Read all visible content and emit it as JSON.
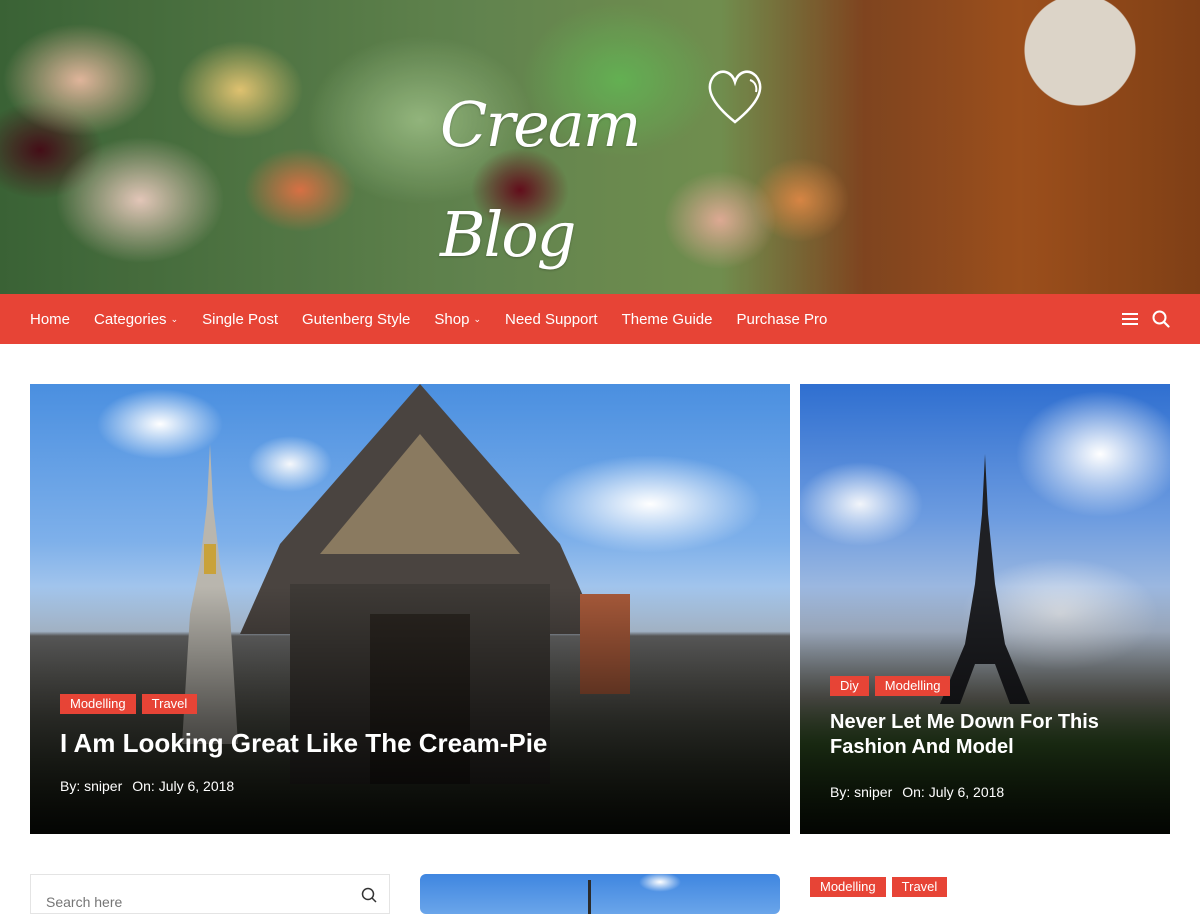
{
  "header": {
    "site_title": "Cream Blog"
  },
  "nav": {
    "items": [
      {
        "label": "Home",
        "has_dropdown": false
      },
      {
        "label": "Categories",
        "has_dropdown": true
      },
      {
        "label": "Single Post",
        "has_dropdown": false
      },
      {
        "label": "Gutenberg Style",
        "has_dropdown": false
      },
      {
        "label": "Shop",
        "has_dropdown": true
      },
      {
        "label": "Need Support",
        "has_dropdown": false
      },
      {
        "label": "Theme Guide",
        "has_dropdown": false
      },
      {
        "label": "Purchase Pro",
        "has_dropdown": false
      }
    ],
    "caret": "⌄",
    "icons": [
      "menu-icon",
      "search-icon"
    ],
    "color": "#e74436"
  },
  "featured": {
    "main": {
      "tags": [
        "Modelling",
        "Travel"
      ],
      "title": "I Am Looking Great Like The Cream-Pie",
      "author": "By: sniper",
      "date": "On: July 6, 2018"
    },
    "side": {
      "tags": [
        "Diy",
        "Modelling"
      ],
      "title": "Never Let Me Down For This Fashion And Model",
      "author": "By: sniper",
      "date": "On: July 6, 2018"
    }
  },
  "sidebar": {
    "search_placeholder": "Search here"
  },
  "post_list": {
    "first_tags": [
      "Modelling",
      "Travel"
    ]
  }
}
